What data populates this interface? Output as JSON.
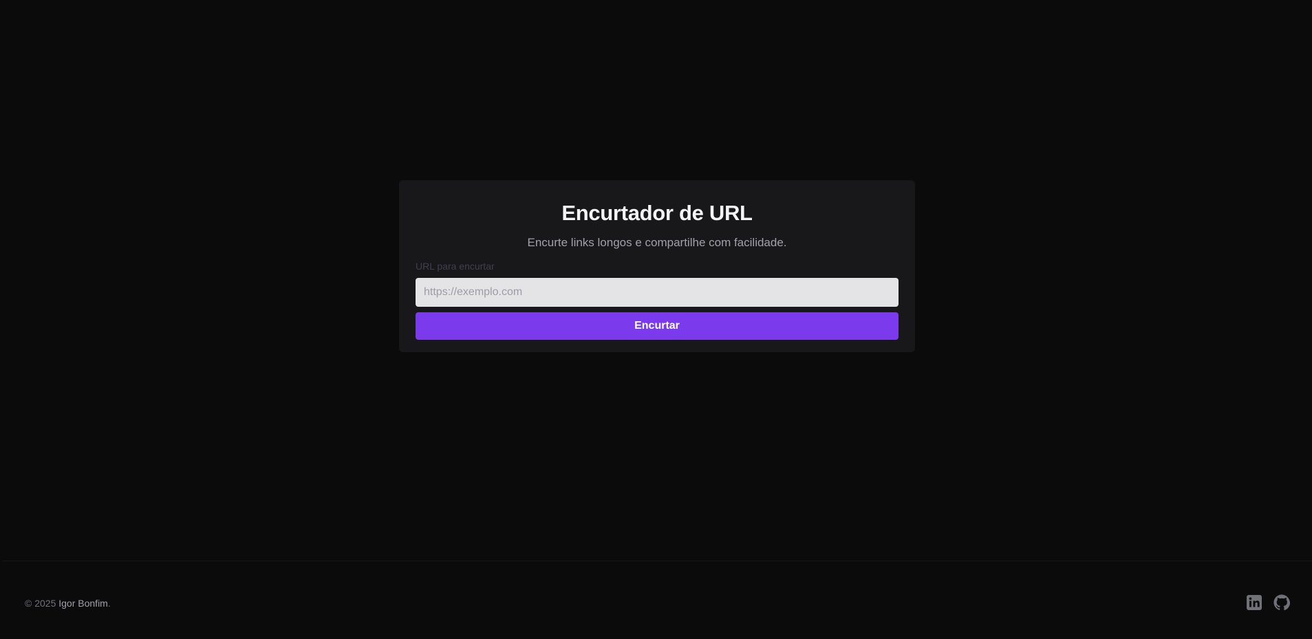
{
  "card": {
    "title": "Encurtador de URL",
    "subtitle": "Encurte links longos e compartilhe com facilidade.",
    "field_label": "URL para encurtar",
    "input_placeholder": "https://exemplo.com",
    "input_value": "",
    "submit_label": "Encurtar"
  },
  "footer": {
    "copyright_prefix": "© 2025 ",
    "author": "Igor Bonfim",
    "copyright_suffix": ".",
    "social": [
      {
        "icon": "linkedin-icon"
      },
      {
        "icon": "github-icon"
      }
    ]
  },
  "colors": {
    "background": "#0b0b0c",
    "card": "#18181b",
    "accent": "#7c3aed",
    "input": "#e4e4e7"
  }
}
